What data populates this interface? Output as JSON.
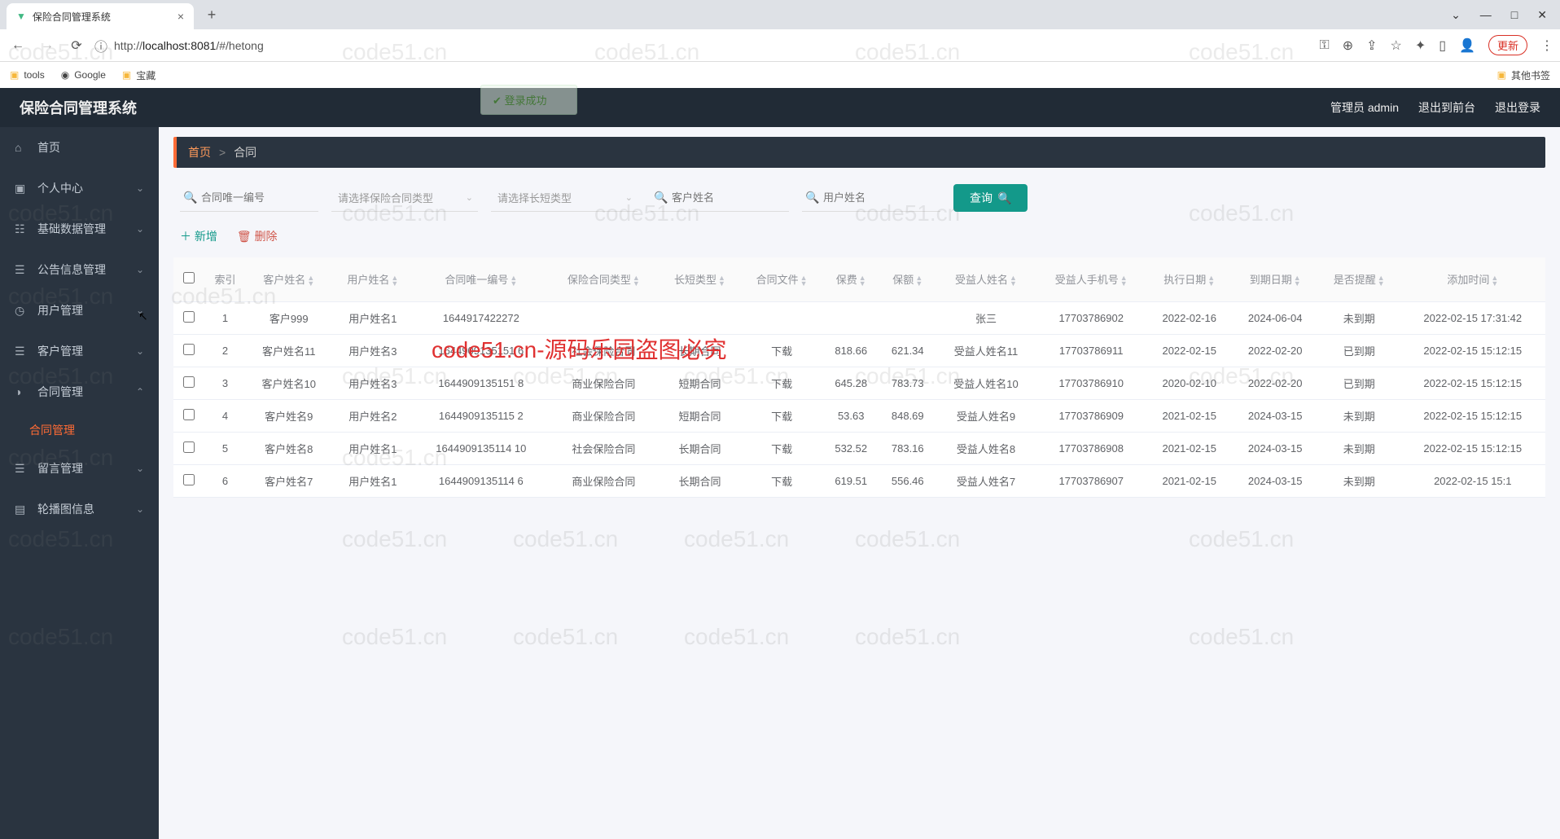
{
  "browser": {
    "tab_title": "保险合同管理系统",
    "url_scheme": "http://",
    "url_host": "localhost:8081",
    "url_path": "/#/hetong",
    "new_tab": "+",
    "update_btn": "更新",
    "bookmarks": {
      "tools": "tools",
      "google": "Google",
      "treasure": "宝藏",
      "other": "其他书签"
    }
  },
  "header": {
    "title": "保险合同管理系统",
    "admin": "管理员 admin",
    "front": "退出到前台",
    "logout": "退出登录"
  },
  "sidebar": [
    {
      "icon": "⌂",
      "label": "首页",
      "chev": ""
    },
    {
      "icon": "▣",
      "label": "个人中心",
      "chev": "⌄"
    },
    {
      "icon": "☷",
      "label": "基础数据管理",
      "chev": "⌄"
    },
    {
      "icon": "☰",
      "label": "公告信息管理",
      "chev": "⌄"
    },
    {
      "icon": "◷",
      "label": "用户管理",
      "chev": "⌄"
    },
    {
      "icon": "☰",
      "label": "客户管理",
      "chev": "⌄"
    },
    {
      "icon": "◑",
      "label": "合同管理",
      "chev": "⌃"
    },
    {
      "icon": "☰",
      "label": "留言管理",
      "chev": "⌄"
    },
    {
      "icon": "▤",
      "label": "轮播图信息",
      "chev": "⌄"
    }
  ],
  "submenu_active": "合同管理",
  "crumb": {
    "home": "首页",
    "sep": ">",
    "current": "合同"
  },
  "filters": {
    "f1_ph": "合同唯一编号",
    "f2_ph": "请选择保险合同类型",
    "f3_ph": "请选择长短类型",
    "f4_ph": "客户姓名",
    "f5_ph": "用户姓名",
    "query": "查询"
  },
  "ops": {
    "add": "新增",
    "del": "删除"
  },
  "cols": [
    "",
    "索引",
    "客户姓名",
    "用户姓名",
    "合同唯一编号",
    "保险合同类型",
    "长短类型",
    "合同文件",
    "保费",
    "保额",
    "受益人姓名",
    "受益人手机号",
    "执行日期",
    "到期日期",
    "是否提醒",
    "添加时间"
  ],
  "rows": [
    {
      "idx": "1",
      "cust": "客户999",
      "user": "用户姓名1",
      "code": "1644917422272",
      "ctype": "",
      "ltype": "",
      "file": "",
      "fee": "",
      "amt": "",
      "bname": "张三",
      "bphone": "17703786902",
      "start": "2022-02-16",
      "end": "2024-06-04",
      "warn": "未到期",
      "time": "2022-02-15 17:31:42"
    },
    {
      "idx": "2",
      "cust": "客户姓名11",
      "user": "用户姓名3",
      "code": "1644909135151 6",
      "ctype": "社会保险合同",
      "ltype": "长期合同",
      "file": "下载",
      "fee": "818.66",
      "amt": "621.34",
      "bname": "受益人姓名11",
      "bphone": "17703786911",
      "start": "2022-02-15",
      "end": "2022-02-20",
      "warn": "已到期",
      "time": "2022-02-15 15:12:15"
    },
    {
      "idx": "3",
      "cust": "客户姓名10",
      "user": "用户姓名3",
      "code": "1644909135151 8",
      "ctype": "商业保险合同",
      "ltype": "短期合同",
      "file": "下载",
      "fee": "645.28",
      "amt": "783.73",
      "bname": "受益人姓名10",
      "bphone": "17703786910",
      "start": "2020-02-10",
      "end": "2022-02-20",
      "warn": "已到期",
      "time": "2022-02-15 15:12:15"
    },
    {
      "idx": "4",
      "cust": "客户姓名9",
      "user": "用户姓名2",
      "code": "1644909135115 2",
      "ctype": "商业保险合同",
      "ltype": "短期合同",
      "file": "下载",
      "fee": "53.63",
      "amt": "848.69",
      "bname": "受益人姓名9",
      "bphone": "17703786909",
      "start": "2021-02-15",
      "end": "2024-03-15",
      "warn": "未到期",
      "time": "2022-02-15 15:12:15"
    },
    {
      "idx": "5",
      "cust": "客户姓名8",
      "user": "用户姓名1",
      "code": "1644909135114 10",
      "ctype": "社会保险合同",
      "ltype": "长期合同",
      "file": "下载",
      "fee": "532.52",
      "amt": "783.16",
      "bname": "受益人姓名8",
      "bphone": "17703786908",
      "start": "2021-02-15",
      "end": "2024-03-15",
      "warn": "未到期",
      "time": "2022-02-15 15:12:15"
    },
    {
      "idx": "6",
      "cust": "客户姓名7",
      "user": "用户姓名1",
      "code": "1644909135114 6",
      "ctype": "商业保险合同",
      "ltype": "长期合同",
      "file": "下载",
      "fee": "619.51",
      "amt": "556.46",
      "bname": "受益人姓名7",
      "bphone": "17703786907",
      "start": "2021-02-15",
      "end": "2024-03-15",
      "warn": "未到期",
      "time": "2022-02-15 15:1"
    }
  ],
  "watermark": "code51.cn",
  "redtext": "code51.cn-源码乐园盗图必究",
  "toast": "登录成功"
}
